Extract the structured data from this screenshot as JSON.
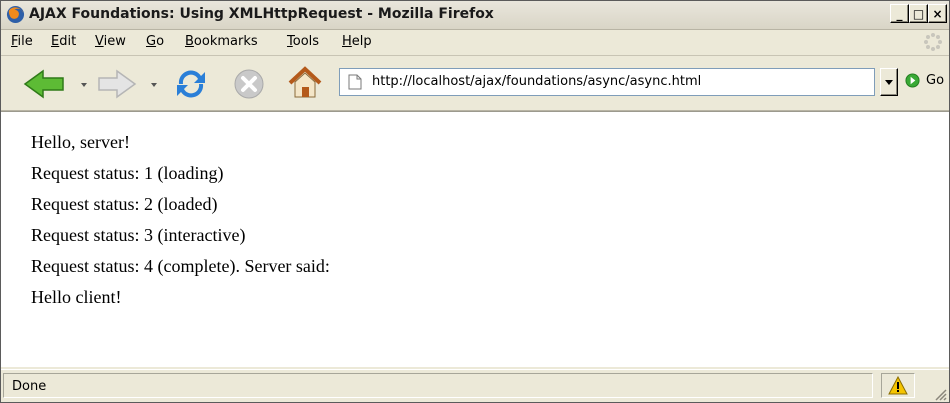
{
  "window": {
    "title": "AJAX Foundations: Using XMLHttpRequest - Mozilla Firefox",
    "buttons": {
      "minimize": "_",
      "maximize": "□",
      "close": "×"
    }
  },
  "menu": [
    {
      "label_u": "F",
      "label_rest": "ile"
    },
    {
      "label_u": "E",
      "label_rest": "dit"
    },
    {
      "label_u": "V",
      "label_rest": "iew"
    },
    {
      "label_u": "G",
      "label_rest": "o"
    },
    {
      "label_u": "B",
      "label_rest": "ookmarks"
    },
    {
      "label_u": "T",
      "label_rest": "ools"
    },
    {
      "label_u": "H",
      "label_rest": "elp"
    }
  ],
  "toolbar": {
    "icons": [
      "back-icon",
      "forward-icon",
      "reload-icon",
      "stop-icon",
      "home-icon"
    ],
    "url": "http://localhost/ajax/foundations/async/async.html",
    "go_label": "Go"
  },
  "content": {
    "lines": [
      "Hello, server!",
      "Request status: 1 (loading)",
      "Request status: 2 (loaded)",
      "Request status: 3 (interactive)",
      "Request status: 4 (complete). Server said:",
      "Hello client!"
    ]
  },
  "status": {
    "text": "Done"
  },
  "colors": {
    "back_arrow": "#4caf2f",
    "reload": "#2a7fd8",
    "stop": "#b8b8b8",
    "warning": "#f5c400"
  }
}
